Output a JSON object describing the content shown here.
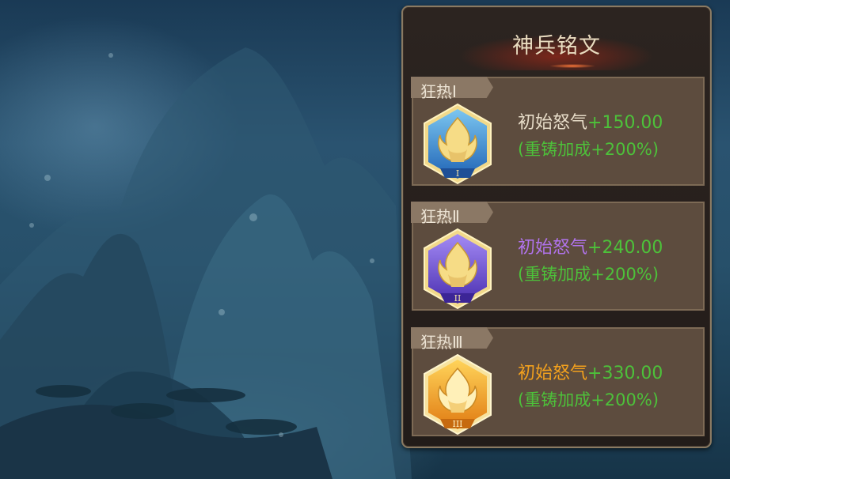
{
  "panel": {
    "title": "神兵铭文",
    "cards": [
      {
        "tag": "狂热Ⅰ",
        "emblem_icon": "flame-emblem-blue-icon",
        "emblem_numeral": "I",
        "emblem_color": "#3a8fd0",
        "stat_name": "初始怒气",
        "stat_name_color": "#e7dcc8",
        "stat_value": "+150.00",
        "bonus": "(重铸加成+200%)"
      },
      {
        "tag": "狂热Ⅱ",
        "emblem_icon": "flame-emblem-purple-icon",
        "emblem_numeral": "II",
        "emblem_color": "#6f4fd8",
        "stat_name": "初始怒气",
        "stat_name_color": "#b173ec",
        "stat_value": "+240.00",
        "bonus": "(重铸加成+200%)"
      },
      {
        "tag": "狂热Ⅲ",
        "emblem_icon": "flame-emblem-gold-icon",
        "emblem_numeral": "III",
        "emblem_color": "#f0a020",
        "stat_name": "初始怒气",
        "stat_name_color": "#f3a11d",
        "stat_value": "+330.00",
        "bonus": "(重铸加成+200%)"
      }
    ]
  },
  "colors": {
    "bonus_green": "#4dc13a",
    "panel_border": "#8a7a62"
  }
}
